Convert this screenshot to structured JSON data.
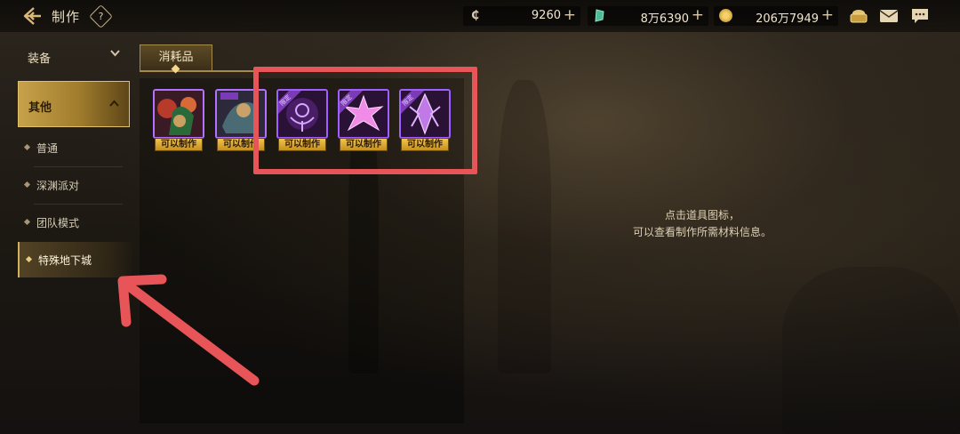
{
  "header": {
    "title": "制作",
    "help_symbol": "?",
    "currencies": [
      {
        "name": "coin-currency",
        "value": "9260",
        "plus": "+"
      },
      {
        "name": "gem-currency",
        "value": "8万6390",
        "plus": "+"
      },
      {
        "name": "gold-currency",
        "value": "206万7949",
        "plus": "+"
      }
    ],
    "icons": [
      "treasure-icon",
      "mail-icon",
      "chat-icon"
    ]
  },
  "sidebar": {
    "categories": [
      {
        "label": "装备",
        "chevron": "⌄"
      },
      {
        "label": "其他",
        "chevron": "⌃"
      }
    ],
    "subitems": [
      {
        "label": "普通"
      },
      {
        "label": "深渊派对"
      },
      {
        "label": "团队模式"
      },
      {
        "label": "特殊地下城"
      }
    ]
  },
  "panel": {
    "tab_label": "消耗品",
    "items": [
      {
        "tag": "可以制作",
        "limited": ""
      },
      {
        "tag": "可以制作",
        "limited": ""
      },
      {
        "tag": "可以制作",
        "limited": "限定"
      },
      {
        "tag": "可以制作",
        "limited": "限定"
      },
      {
        "tag": "可以制作",
        "limited": "限定"
      }
    ]
  },
  "detail": {
    "hint_line1": "点击道具图标，",
    "hint_line2": "可以查看制作所需材料信息。"
  },
  "colors": {
    "accent_gold": "#c8a24a",
    "highlight_red": "#e85558",
    "item_border_purple": "#a060ff"
  }
}
